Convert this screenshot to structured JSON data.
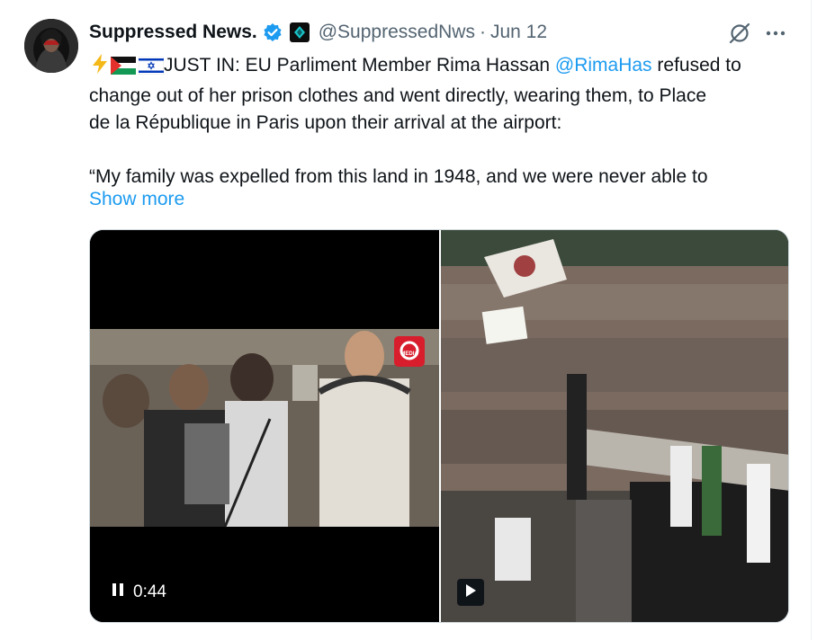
{
  "tweet": {
    "display_name": "Suppressed News.",
    "handle": "@SuppressedNws",
    "separator": "·",
    "date": "Jun 12",
    "text_line1_prefix": "JUST IN: EU Parliment Member Rima Hassan ",
    "mention": "@RimaHas",
    "text_line1_suffix": " refused to",
    "text_line2": "change out of her prison clothes and went directly, wearing them, to Place",
    "text_line3": "de la République in Paris upon their arrival at the airport:",
    "text_line5": "“My family was expelled from this land in 1948, and we were never able to",
    "show_more": "Show more"
  },
  "media": {
    "video_time": "0:44",
    "watermark": "MEDIA"
  },
  "icons": {
    "verified": "verified-badge-icon",
    "affiliate": "affiliate-badge-icon",
    "grok": "grok-icon",
    "more": "more-icon",
    "lightning": "lightning-emoji",
    "flag1": "palestine-flag-emoji",
    "flag2": "israel-flag-emoji",
    "pause": "pause-icon",
    "play": "play-icon"
  },
  "colors": {
    "link": "#1d9bf0",
    "secondary_text": "#536471",
    "primary_text": "#0f1419"
  }
}
